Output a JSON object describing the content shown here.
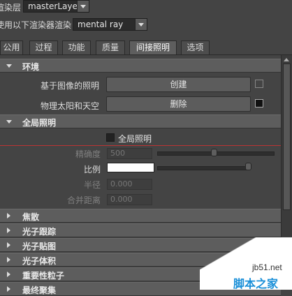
{
  "renderer_row": {
    "label": "渲染层",
    "value": "masterLayer"
  },
  "using_row": {
    "label": "使用以下渲染器渲染",
    "value": "mental ray"
  },
  "tabs": [
    {
      "label": "公用"
    },
    {
      "label": "过程"
    },
    {
      "label": "功能"
    },
    {
      "label": "质量"
    },
    {
      "label": "间接照明"
    },
    {
      "label": "选项"
    }
  ],
  "environment": {
    "title": "环境",
    "ibl_label": "基于图像的照明",
    "create_label": "创建",
    "sun_sky_label": "物理太阳和天空",
    "delete_label": "删除"
  },
  "global_illumination": {
    "title": "全局照明",
    "checkbox_label": "全局照明",
    "accuracy_label": "精确度",
    "accuracy_value": "500",
    "scale_label": "比例",
    "radius_label": "半径",
    "radius_value": "0.000",
    "merge_label": "合并距离",
    "merge_value": "0.000"
  },
  "collapsed_sections": [
    {
      "title": "焦散"
    },
    {
      "title": "光子跟踪"
    },
    {
      "title": "光子贴图"
    },
    {
      "title": "光子体积"
    },
    {
      "title": "重要性粒子"
    },
    {
      "title": "最终聚集"
    }
  ],
  "watermark": {
    "site": "jb51.net",
    "name": "脚本之家"
  }
}
